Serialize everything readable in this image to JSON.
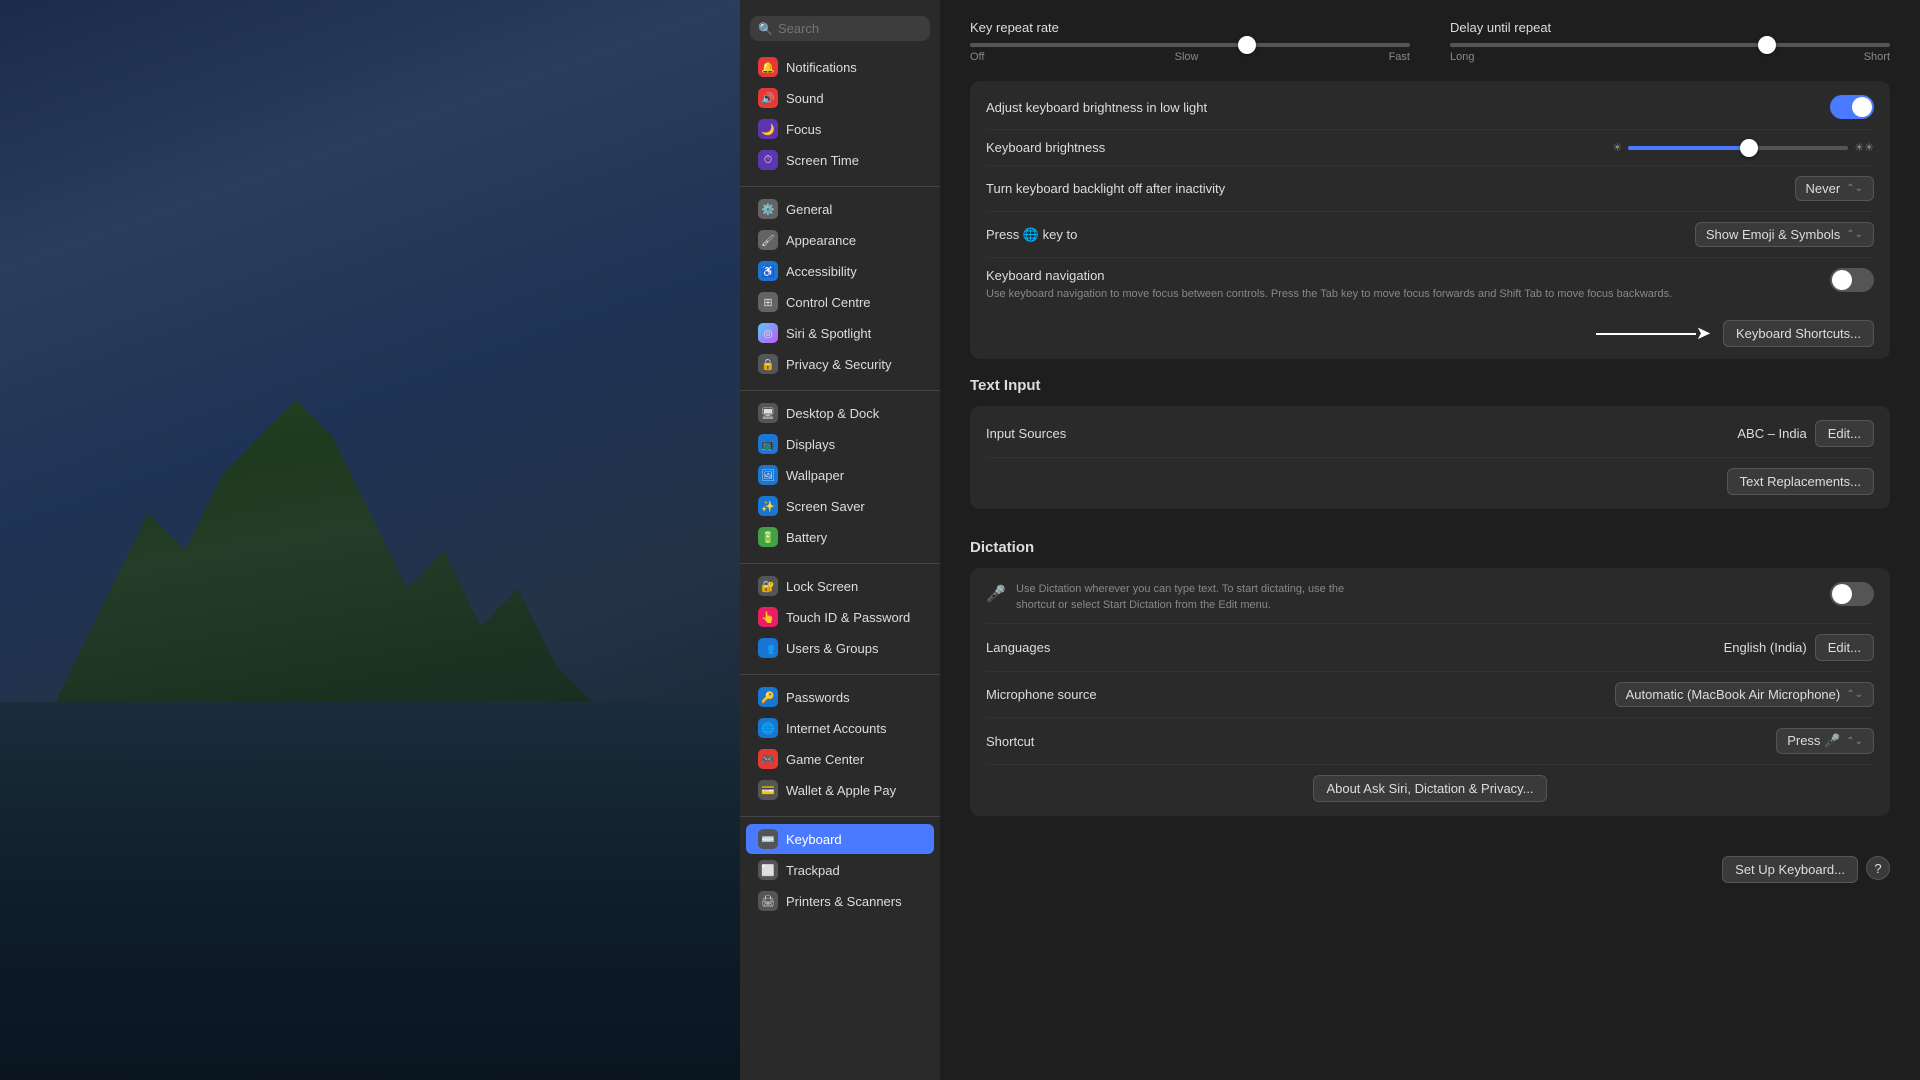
{
  "wallpaper": {
    "alt": "macOS Monterey Wallpaper"
  },
  "search": {
    "placeholder": "Search"
  },
  "sidebar": {
    "groups": [
      {
        "items": [
          {
            "id": "notifications",
            "label": "Notifications",
            "icon": "notifications",
            "iconColor": "icon-notifications"
          },
          {
            "id": "sound",
            "label": "Sound",
            "icon": "sound",
            "iconColor": "icon-sound"
          },
          {
            "id": "focus",
            "label": "Focus",
            "icon": "focus",
            "iconColor": "icon-focus"
          },
          {
            "id": "screentime",
            "label": "Screen Time",
            "icon": "screentime",
            "iconColor": "icon-screentime"
          }
        ]
      },
      {
        "items": [
          {
            "id": "general",
            "label": "General",
            "icon": "general",
            "iconColor": "icon-general"
          },
          {
            "id": "appearance",
            "label": "Appearance",
            "icon": "appearance",
            "iconColor": "icon-appearance"
          },
          {
            "id": "accessibility",
            "label": "Accessibility",
            "icon": "accessibility",
            "iconColor": "icon-accessibility"
          },
          {
            "id": "controlcentre",
            "label": "Control Centre",
            "icon": "controlcentre",
            "iconColor": "icon-controlcentre"
          },
          {
            "id": "siri",
            "label": "Siri & Spotlight",
            "icon": "siri",
            "iconColor": "icon-siri"
          },
          {
            "id": "privacy",
            "label": "Privacy & Security",
            "icon": "privacy",
            "iconColor": "icon-privacy"
          }
        ]
      },
      {
        "items": [
          {
            "id": "desktopdock",
            "label": "Desktop & Dock",
            "icon": "desktopdock",
            "iconColor": "icon-desktopdock"
          },
          {
            "id": "displays",
            "label": "Displays",
            "icon": "displays",
            "iconColor": "icon-displays"
          },
          {
            "id": "wallpaper",
            "label": "Wallpaper",
            "icon": "wallpaper",
            "iconColor": "icon-wallpaper"
          },
          {
            "id": "screensaver",
            "label": "Screen Saver",
            "icon": "screensaver",
            "iconColor": "icon-screensaver"
          },
          {
            "id": "battery",
            "label": "Battery",
            "icon": "battery",
            "iconColor": "icon-battery"
          }
        ]
      },
      {
        "items": [
          {
            "id": "lockscreen",
            "label": "Lock Screen",
            "icon": "lockscreen",
            "iconColor": "icon-lockscreen"
          },
          {
            "id": "touchid",
            "label": "Touch ID & Password",
            "icon": "touchid",
            "iconColor": "icon-touchid"
          },
          {
            "id": "users",
            "label": "Users & Groups",
            "icon": "users",
            "iconColor": "icon-users"
          }
        ]
      },
      {
        "items": [
          {
            "id": "passwords",
            "label": "Passwords",
            "icon": "passwords",
            "iconColor": "icon-passwords"
          },
          {
            "id": "internet",
            "label": "Internet Accounts",
            "icon": "internet",
            "iconColor": "icon-internet"
          },
          {
            "id": "gamecenter",
            "label": "Game Center",
            "icon": "gamecenter",
            "iconColor": "icon-gamecenter"
          },
          {
            "id": "wallet",
            "label": "Wallet & Apple Pay",
            "icon": "wallet",
            "iconColor": "icon-wallet"
          }
        ]
      },
      {
        "items": [
          {
            "id": "keyboard",
            "label": "Keyboard",
            "icon": "keyboard",
            "iconColor": "icon-keyboard",
            "active": true
          },
          {
            "id": "trackpad",
            "label": "Trackpad",
            "icon": "trackpad",
            "iconColor": "icon-trackpad"
          },
          {
            "id": "printers",
            "label": "Printers & Scanners",
            "icon": "printers",
            "iconColor": "icon-printers"
          }
        ]
      }
    ]
  },
  "main": {
    "keyRepeatRate": {
      "label": "Key repeat rate",
      "thumbPosition": "63",
      "labelLeft": "Off",
      "labelLeft2": "Slow",
      "labelRight": "Fast"
    },
    "delayUntilRepeat": {
      "label": "Delay until repeat",
      "thumbPosition": "72",
      "labelLeft": "Long",
      "labelRight": "Short"
    },
    "adjustBrightness": {
      "label": "Adjust keyboard brightness in low light",
      "toggleOn": true
    },
    "keyboardBrightness": {
      "label": "Keyboard brightness",
      "thumbPosition": "55",
      "iconLeft": "☀",
      "iconRight": "☀"
    },
    "turnOffBacklight": {
      "label": "Turn keyboard backlight off after inactivity",
      "value": "Never"
    },
    "pressGlobeKey": {
      "label": "Press 🌐 key to",
      "value": "Show Emoji & Symbols"
    },
    "keyboardNav": {
      "title": "Keyboard navigation",
      "desc": "Use keyboard navigation to move focus between controls. Press the Tab key to move focus forwards and Shift Tab to move focus backwards.",
      "toggleOn": false
    },
    "keyboardShortcutsBtn": "Keyboard Shortcuts...",
    "textInput": {
      "sectionHeader": "Text Input",
      "inputSources": {
        "label": "Input Sources",
        "value": "ABC – India",
        "editBtn": "Edit..."
      },
      "textReplacementsBtn": "Text Replacements..."
    },
    "dictation": {
      "sectionHeader": "Dictation",
      "desc": "Use Dictation wherever you can type text. To start dictating, use the shortcut or select Start Dictation from the Edit menu.",
      "toggleOn": false,
      "languages": {
        "label": "Languages",
        "value": "English (India)",
        "editBtn": "Edit..."
      },
      "micSource": {
        "label": "Microphone source",
        "value": "Automatic (MacBook Air Microphone)"
      },
      "shortcut": {
        "label": "Shortcut",
        "value": "Press 🎤"
      },
      "aboutBtn": "About Ask Siri, Dictation & Privacy..."
    },
    "setUpKeyboardBtn": "Set Up Keyboard...",
    "helpBtn": "?"
  }
}
